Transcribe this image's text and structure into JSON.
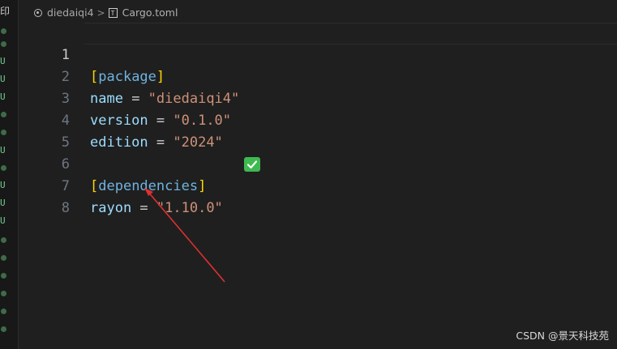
{
  "gutter": {
    "top_icon": "印",
    "marks": [
      "U",
      "U",
      "U",
      "U",
      "U",
      "U",
      "U"
    ]
  },
  "breadcrumb": {
    "folder": "diedaiqi4",
    "separator": ">",
    "file_icon_glyph": "T",
    "file": "Cargo.toml"
  },
  "editor": {
    "active_line": 1,
    "lines": [
      {
        "num": "1",
        "bracket_open": "[",
        "section": "package",
        "bracket_close": "]"
      },
      {
        "num": "2",
        "key": "name",
        "eq": " = ",
        "value": "\"diedaiqi4\""
      },
      {
        "num": "3",
        "key": "version",
        "eq": " = ",
        "value": "\"0.1.0\""
      },
      {
        "num": "4",
        "key": "edition",
        "eq": " = ",
        "value": "\"2024\""
      },
      {
        "num": "5"
      },
      {
        "num": "6",
        "bracket_open": "[",
        "section": "dependencies",
        "bracket_close": "]"
      },
      {
        "num": "7",
        "key": "rayon",
        "eq": " = ",
        "value": "\"1.10.0\"",
        "status_icon": "check-icon"
      },
      {
        "num": "8"
      }
    ]
  },
  "annotation": {
    "type": "red-arrow",
    "color": "#e03030"
  },
  "watermark": "CSDN @景天科技苑"
}
